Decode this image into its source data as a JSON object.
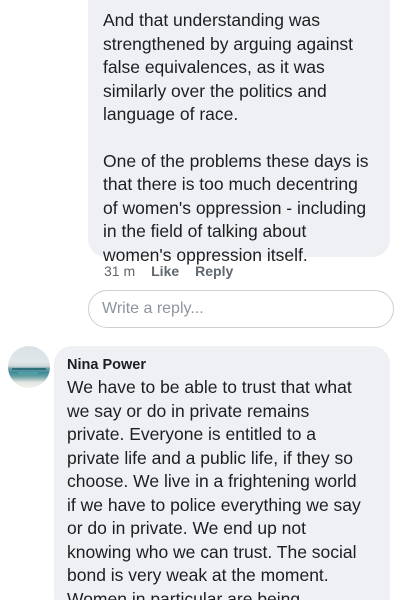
{
  "comment1": {
    "paragraphs": [
      "And that understanding was\nstrengthened by arguing against\nfalse equivalences, as it was\nsimilarly over the politics and\nlanguage of race.",
      "One of the problems these days is\nthat there is too much decentring\nof women's oppression - including\nin the field of talking about\nwomen's oppression itself."
    ],
    "time": "31 m",
    "like_label": "Like",
    "reply_label": "Reply"
  },
  "reply_box": {
    "placeholder": "Write a reply..."
  },
  "comment2": {
    "author": "Nina Power",
    "text": "We have to be able to trust that what\nwe say or do in private remains\nprivate. Everyone is entitled to a\nprivate life and a public life, if they so\nchoose. We live in a frightening world\nif we have to police everything we say\nor do in private. We end up not\nknowing who we can trust. The social\nbond is very weak at the moment.\nWomen in particular are being"
  }
}
